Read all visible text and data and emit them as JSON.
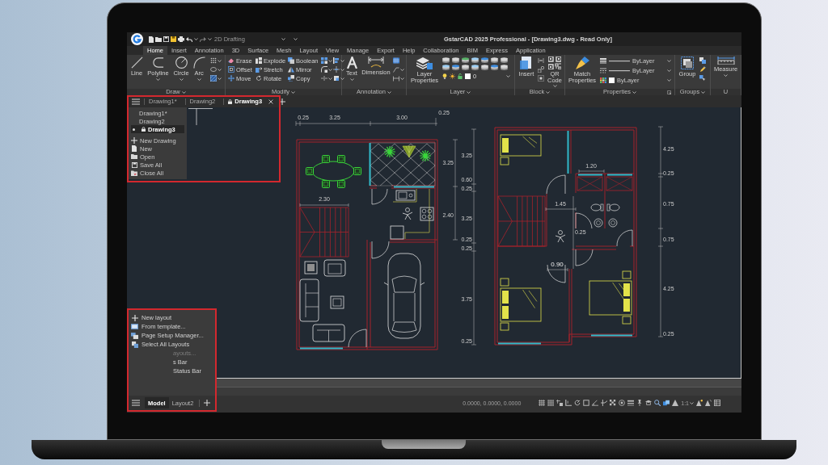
{
  "title_bar": {
    "workspace": "2D Drafting",
    "title": "GstarCAD 2025 Professional - [Drawing3.dwg - Read Only]"
  },
  "ribbon_tabs": [
    {
      "label": "Home",
      "selected": true
    },
    {
      "label": "Insert",
      "selected": false
    },
    {
      "label": "Annotation",
      "selected": false
    },
    {
      "label": "3D",
      "selected": false
    },
    {
      "label": "Surface",
      "selected": false
    },
    {
      "label": "Mesh",
      "selected": false
    },
    {
      "label": "Layout",
      "selected": false
    },
    {
      "label": "View",
      "selected": false
    },
    {
      "label": "Manage",
      "selected": false
    },
    {
      "label": "Export",
      "selected": false
    },
    {
      "label": "Help",
      "selected": false
    },
    {
      "label": "Collaboration",
      "selected": false
    },
    {
      "label": "BIM",
      "selected": false
    },
    {
      "label": "Express",
      "selected": false
    },
    {
      "label": "Application",
      "selected": false
    }
  ],
  "ribbon_panels": [
    {
      "kind": "draw",
      "label": "Draw",
      "buttons": [
        {
          "label": "Line",
          "dropdown": false
        },
        {
          "label": "Polyline",
          "dropdown": true
        },
        {
          "label": "Circle",
          "dropdown": true
        },
        {
          "label": "Arc",
          "dropdown": true
        }
      ]
    },
    {
      "kind": "modify",
      "label": "Modify",
      "buttons": [
        "Erase",
        "Explode",
        "Boolean",
        "Offset",
        "Stretch",
        "Mirror",
        "Move",
        "Rotate",
        "Copy"
      ]
    },
    {
      "kind": "annotation",
      "label": "Annotation",
      "buttons": [
        {
          "label": "Text",
          "dropdown": true
        },
        {
          "label": "Dimension",
          "dropdown": false
        }
      ]
    },
    {
      "kind": "layer",
      "label": "Layer",
      "buttons": [
        {
          "label": "Layer Properties",
          "dropdown": false
        }
      ],
      "current_layer": "0"
    },
    {
      "kind": "block",
      "label": "Block",
      "buttons": [
        {
          "label": "Insert",
          "dropdown": false
        },
        {
          "label": "QR Code",
          "dropdown": true
        }
      ]
    },
    {
      "kind": "properties",
      "label": "Properties",
      "buttons": [
        {
          "label": "Match Properties",
          "dropdown": false
        }
      ],
      "property_values": [
        "ByLayer",
        "ByLayer",
        "ByLayer"
      ]
    },
    {
      "kind": "groups",
      "label": "Groups",
      "buttons": [
        {
          "label": "Group",
          "dropdown": false
        }
      ]
    },
    {
      "kind": "utilities",
      "label": "U",
      "buttons": [
        {
          "label": "Measure",
          "dropdown": true
        }
      ]
    }
  ],
  "document_tabs": [
    {
      "label": "Drawing1*",
      "selected": false,
      "locked": false
    },
    {
      "label": "Drawing2",
      "selected": false,
      "locked": false
    },
    {
      "label": "Drawing3",
      "selected": true,
      "locked": true
    }
  ],
  "document_menu": {
    "drawings": [
      {
        "label": "Drawing1*",
        "selected": false,
        "locked": false
      },
      {
        "label": "Drawing2",
        "selected": false,
        "locked": false
      },
      {
        "label": "Drawing3",
        "selected": true,
        "locked": true
      }
    ],
    "actions": [
      "New Drawing",
      "New",
      "Open",
      "Save All",
      "Close All"
    ]
  },
  "drawing": {
    "dimension_labels": [
      "0.25",
      "3.25",
      "3.00",
      "0.25",
      "2.30",
      "3.25",
      "2.40",
      "3.25",
      "0.60",
      "0.25",
      "3.25",
      "0.25",
      "0.25",
      "3.75",
      "0.25",
      "1.20",
      "1.45",
      "0.25",
      "0.90",
      "4.25",
      "0.25",
      "0.75",
      "0.75",
      "4.25",
      "0.25"
    ]
  },
  "layout_menu": {
    "items": [
      {
        "label": "New layout",
        "kind": "full",
        "disabled": false
      },
      {
        "label": "From template...",
        "kind": "full",
        "disabled": false
      },
      {
        "label": "Page Setup Manager...",
        "kind": "full",
        "disabled": false
      },
      {
        "label": "Select All Layouts",
        "kind": "full",
        "disabled": false
      },
      {
        "label": "ayouts...",
        "kind": "partial",
        "disabled": true
      },
      {
        "label": "s Bar",
        "kind": "partial",
        "disabled": false
      },
      {
        "label": "Status Bar",
        "kind": "partial",
        "disabled": false
      }
    ]
  },
  "layout_tabs": [
    {
      "label": "Model",
      "selected": true
    },
    {
      "label": "Layout2",
      "selected": false
    }
  ],
  "status_bar": {
    "coordinates": "0.0000, 0.0000, 0.0000",
    "annotation_scale": "1:1"
  }
}
